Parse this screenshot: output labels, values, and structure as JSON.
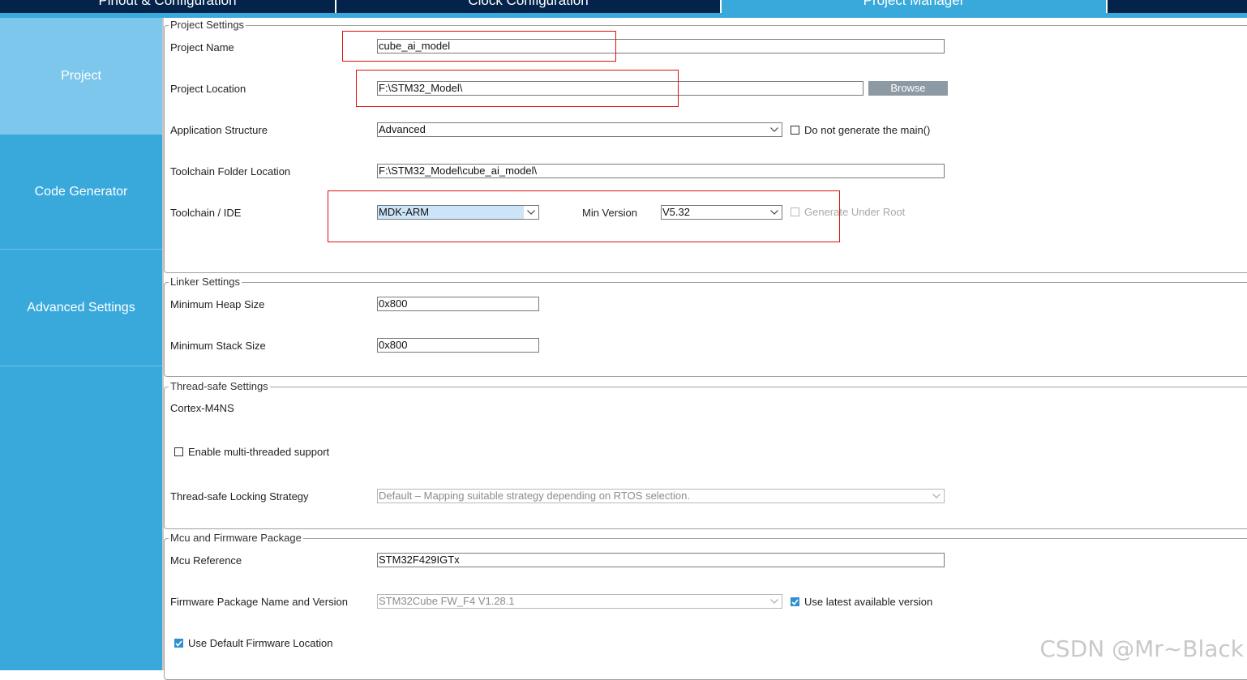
{
  "tabs": [
    {
      "label": "Pinout & Configuration"
    },
    {
      "label": "Clock Configuration"
    },
    {
      "label": "Project Manager"
    },
    {
      "label": ""
    }
  ],
  "sidebar": {
    "items": [
      {
        "label": "Project"
      },
      {
        "label": "Code Generator"
      },
      {
        "label": "Advanced Settings"
      }
    ]
  },
  "project_settings": {
    "title": "Project Settings",
    "project_name_label": "Project Name",
    "project_name_value": "cube_ai_model",
    "project_location_label": "Project Location",
    "project_location_value": "F:\\STM32_Model\\",
    "browse_label": "Browse",
    "app_structure_label": "Application Structure",
    "app_structure_value": "Advanced",
    "no_main_label": "Do not generate the main()",
    "toolchain_folder_label": "Toolchain Folder Location",
    "toolchain_folder_value": "F:\\STM32_Model\\cube_ai_model\\",
    "toolchain_ide_label": "Toolchain / IDE",
    "toolchain_ide_value": "MDK-ARM",
    "min_version_label": "Min Version",
    "min_version_value": "V5.32",
    "gen_under_root_label": "Generate Under Root"
  },
  "linker_settings": {
    "title": "Linker Settings",
    "heap_label": "Minimum Heap Size",
    "heap_value": "0x800",
    "stack_label": "Minimum Stack Size",
    "stack_value": "0x800"
  },
  "thread_settings": {
    "title": "Thread-safe Settings",
    "core_label": "Cortex-M4NS",
    "multithread_label": "Enable multi-threaded support",
    "locking_label": "Thread-safe Locking Strategy",
    "locking_value": "Default  –  Mapping suitable strategy depending on RTOS selection."
  },
  "mcu_settings": {
    "title": "Mcu and Firmware Package",
    "mcu_ref_label": "Mcu Reference",
    "mcu_ref_value": "STM32F429IGTx",
    "fw_label": "Firmware Package Name and Version",
    "fw_value": "STM32Cube FW_F4 V1.28.1",
    "latest_label": "Use latest available version",
    "default_fw_label": "Use Default Firmware Location"
  },
  "watermark": "CSDN @Mr~Black",
  "colors": {
    "tab_dark": "#03234b",
    "accent_blue": "#39a9dc",
    "sidebar_active": "#7dc7ec",
    "annotation_red": "#e01010"
  }
}
